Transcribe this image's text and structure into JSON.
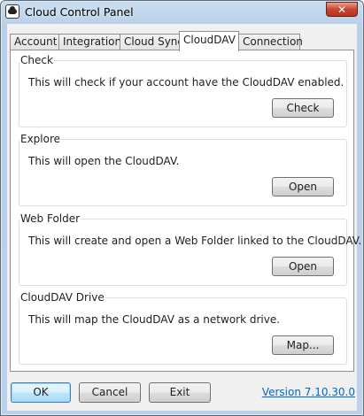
{
  "window": {
    "title": "Cloud Control Panel",
    "close_label": "✕",
    "accent_color": "#c8462f"
  },
  "tabs": [
    {
      "label": "Account",
      "active": false
    },
    {
      "label": "Integration",
      "active": false
    },
    {
      "label": "Cloud Sync",
      "active": false
    },
    {
      "label": "CloudDAV",
      "active": true
    },
    {
      "label": "Connection",
      "active": false
    }
  ],
  "groups": {
    "check": {
      "title": "Check",
      "description": "This will check if your account have the CloudDAV enabled.",
      "button": "Check"
    },
    "explore": {
      "title": "Explore",
      "description": "This will open the CloudDAV.",
      "button": "Open"
    },
    "web_folder": {
      "title": "Web Folder",
      "description": "This will create and open a Web Folder linked to the CloudDAV.",
      "button": "Open"
    },
    "drive": {
      "title": "CloudDAV Drive",
      "description": "This will map the CloudDAV as a network drive.",
      "button": "Map..."
    }
  },
  "footer": {
    "ok": "OK",
    "cancel": "Cancel",
    "exit": "Exit",
    "version": "Version 7.10.30.0"
  }
}
